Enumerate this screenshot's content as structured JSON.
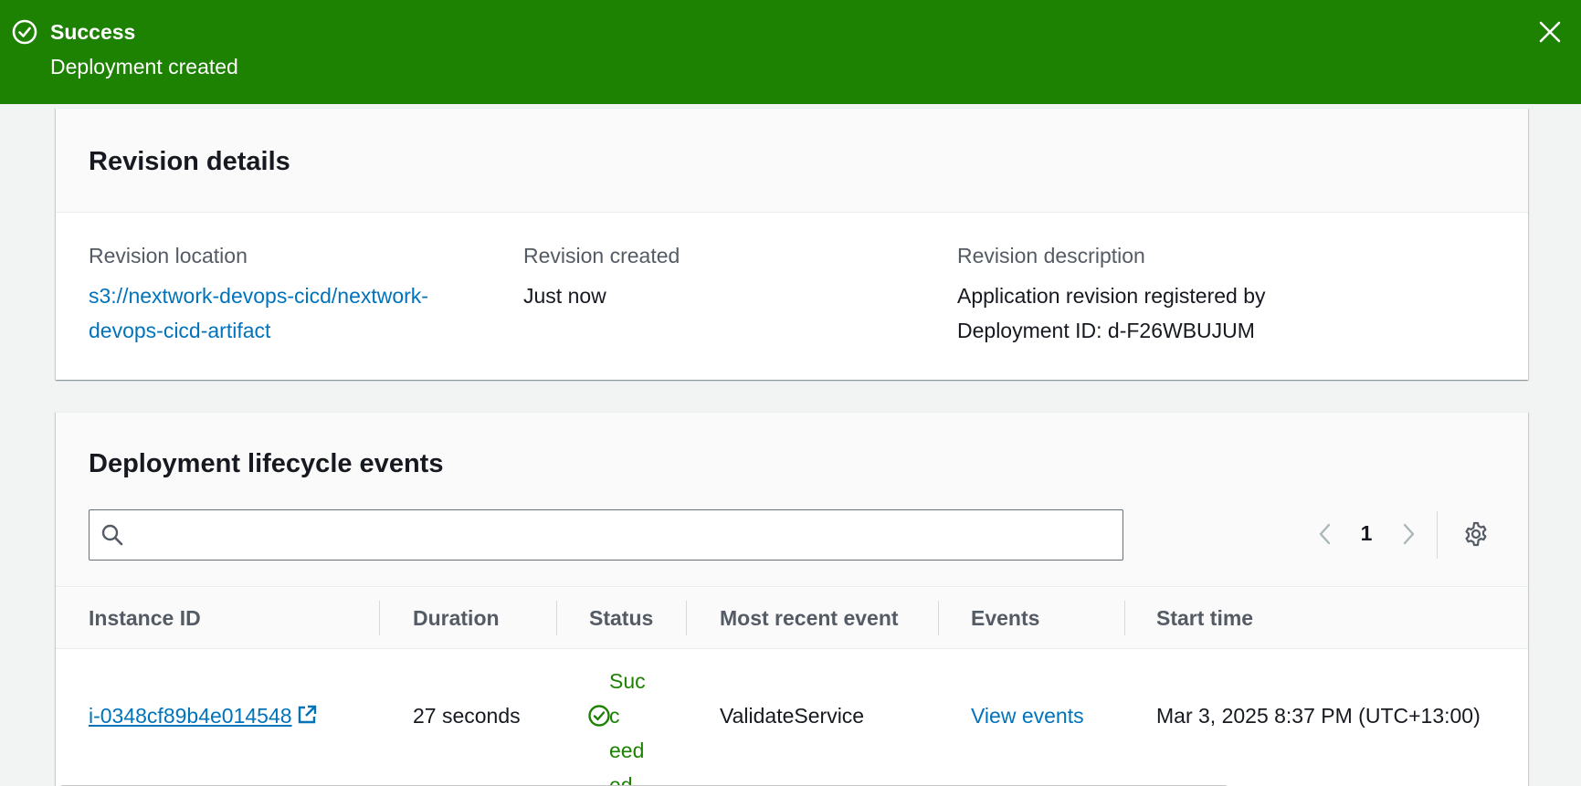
{
  "flash": {
    "header": "Success",
    "content": "Deployment created",
    "color": "#1d8102"
  },
  "revision_details": {
    "title": "Revision details",
    "location_label": "Revision location",
    "location_value": "s3://nextwork-devops-cicd/nextwork-devops-cicd-artifact",
    "location_line1": "s3://nextwork-devops-cicd/nextwork-",
    "location_line2": "devops-cicd-artifact",
    "created_label": "Revision created",
    "created_value": "Just now",
    "description_label": "Revision description",
    "description_line1": "Application revision registered by",
    "description_line2": "Deployment ID: d-F26WBUJUM"
  },
  "lifecycle": {
    "title": "Deployment lifecycle events",
    "search_placeholder": "",
    "search_value": "",
    "current_page": "1",
    "columns": [
      "Instance ID",
      "Duration",
      "Status",
      "Most recent event",
      "Events",
      "Start time"
    ],
    "rows": [
      {
        "instance_id": "i-0348cf89b4e014548",
        "duration": "27 seconds",
        "status": "Succeeded",
        "status_line1": "Succ",
        "status_line2": "eed",
        "status_line3": "ed",
        "most_recent_event": "ValidateService",
        "events_link": "View events",
        "start_time": "Mar 3, 2025 8:37 PM (UTC+13:00)"
      }
    ]
  },
  "icons": {
    "flash": "status-success-icon",
    "close": "close-icon",
    "search": "search-icon",
    "prev": "chevron-left-icon",
    "next": "chevron-right-icon",
    "settings": "gear-icon",
    "external": "external-link-icon",
    "status": "status-success-icon"
  },
  "colors": {
    "link": "#0073bb",
    "success": "#1d8102",
    "label": "#545b64"
  }
}
